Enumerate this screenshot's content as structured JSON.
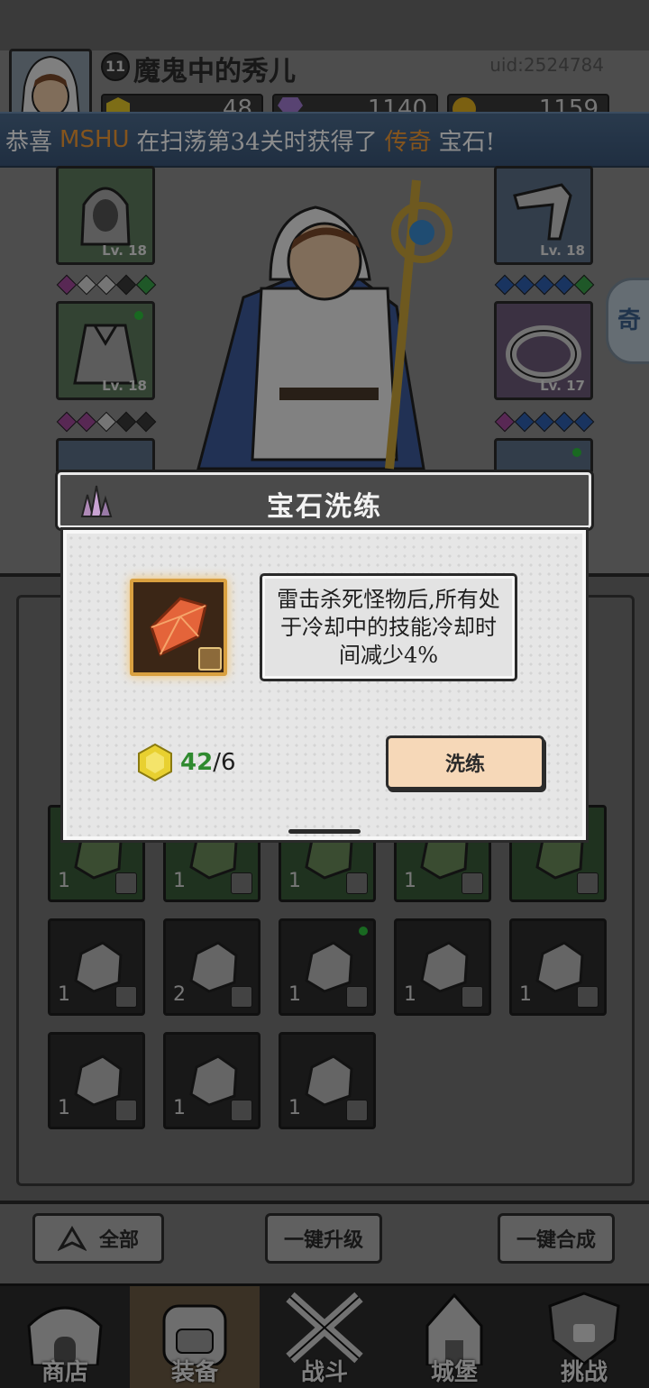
{
  "header": {
    "player_level": "11",
    "player_name": "魔鬼中的秀儿",
    "uid": "uid:2524784",
    "currencies": [
      {
        "icon": "gold-gem-icon",
        "value": "48"
      },
      {
        "icon": "purple-diamond-icon",
        "value": "1140"
      },
      {
        "icon": "gold-coin-icon",
        "value": "1159"
      }
    ]
  },
  "banner": {
    "prefix": "恭喜",
    "player": "MSHU",
    "middle": "在扫荡第34关时获得了",
    "rarity": "传奇",
    "suffix": "宝石!"
  },
  "equipment": {
    "left": [
      {
        "icon": "hood-icon",
        "level": "Lv. 18"
      },
      {
        "icon": "cloak-icon",
        "level": "Lv. 18"
      }
    ],
    "right": [
      {
        "icon": "bracer-icon",
        "level": "Lv. 18"
      },
      {
        "icon": "ring-icon",
        "level": "Lv. 17"
      }
    ]
  },
  "side_tab": {
    "label": "奇"
  },
  "modal": {
    "title": "宝石洗练",
    "description": "雷击杀死怪物后,所有处于冷却中的技能冷却时间减少4%",
    "cost_have": "42",
    "cost_need": "/6",
    "cost_icon": "gold-gem-icon",
    "gem_icon": "orange-gem-icon",
    "refine_label": "洗练"
  },
  "inventory": {
    "rows": [
      [
        "1",
        "1",
        "1",
        "1",
        ""
      ],
      [
        "1",
        "2",
        "1",
        "1",
        "1"
      ],
      [
        "1",
        "1",
        "1"
      ]
    ]
  },
  "actions": {
    "filter_label": "全部",
    "upgrade_label": "一键升级",
    "merge_label": "一键合成"
  },
  "nav": {
    "items": [
      {
        "label": "商店",
        "icon": "shop-icon"
      },
      {
        "label": "装备",
        "icon": "backpack-icon"
      },
      {
        "label": "战斗",
        "icon": "crossed-swords-icon"
      },
      {
        "label": "城堡",
        "icon": "castle-icon"
      },
      {
        "label": "挑战",
        "icon": "challenge-shield-icon"
      }
    ],
    "active": "装备"
  },
  "colors": {
    "banner_highlight": "#f09a36",
    "cost_have": "#2f8a2f",
    "refine_button": "#f6d8b8",
    "gem_frame": "#d9a040"
  }
}
